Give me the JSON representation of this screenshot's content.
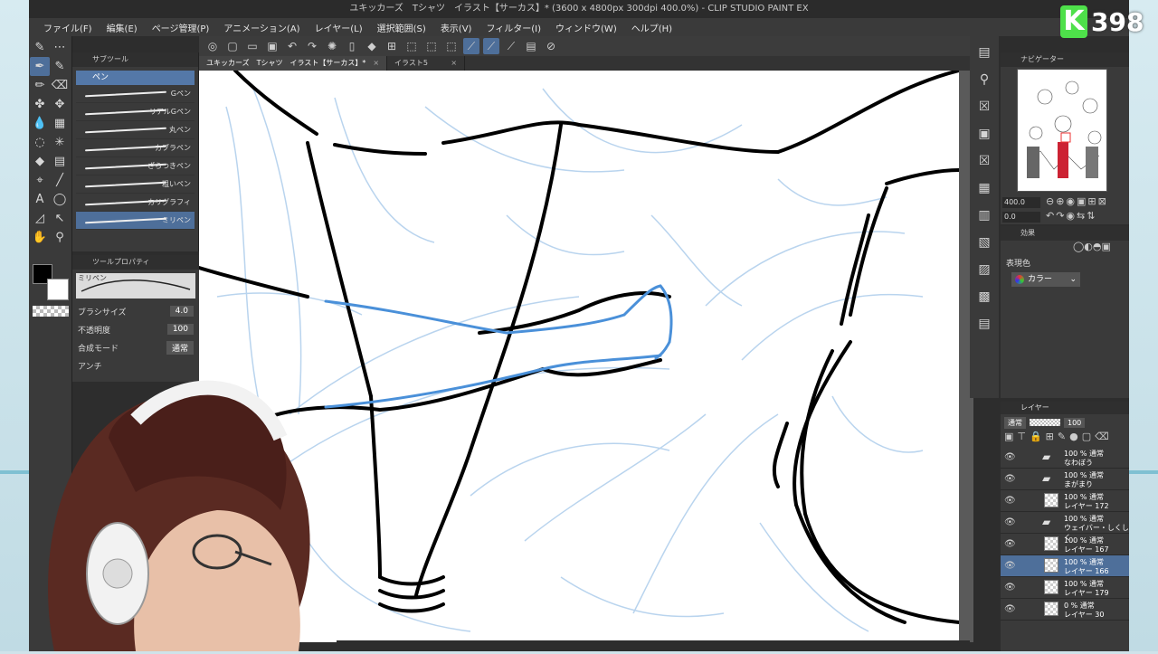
{
  "window": {
    "title": "ユキッカーズ　Tシャツ　イラスト【サーカス】* (3600 x 4800px 300dpi 400.0%) - CLIP STUDIO PAINT EX"
  },
  "menu": [
    "ファイル(F)",
    "編集(E)",
    "ページ管理(P)",
    "アニメーション(A)",
    "レイヤー(L)",
    "選択範囲(S)",
    "表示(V)",
    "フィルター(I)",
    "ウィンドウ(W)",
    "ヘルプ(H)"
  ],
  "document_tabs": [
    {
      "label": "ユキッカーズ　Tシャツ　イラスト【サーカス】*",
      "active": true
    },
    {
      "label": "イラスト5",
      "active": false
    }
  ],
  "subtool": {
    "tab_label": "サブツール",
    "group_label": "ペン",
    "brushes": [
      "Gペン",
      "リアルGペン",
      "丸ペン",
      "カブラペン",
      "ざらつきペン",
      "粗いペン",
      "カリグラフィ",
      "ミリペン"
    ],
    "selected_index": 7
  },
  "tool_property": {
    "tab_label": "ツールプロパティ",
    "preview_label": "ミリペン",
    "brush_size_label": "ブラシサイズ",
    "brush_size_value": "4.0",
    "opacity_label": "不透明度",
    "opacity_value": "100",
    "blend_label": "合成モード",
    "blend_value": "通常",
    "antialias_label": "アンチ"
  },
  "navigator": {
    "tab_label": "ナビゲーター",
    "zoom_value": "400.0",
    "rotate_value": "0.0"
  },
  "effect": {
    "tab_label": "効果",
    "expression_color_label": "表現色",
    "expression_color_value": "カラー"
  },
  "layers": {
    "tab_label": "レイヤー",
    "blend_value": "通常",
    "opacity_value": "100",
    "rows": [
      {
        "percent": "100 % 通常",
        "name": "なわぼう",
        "type": "folder",
        "selected": false
      },
      {
        "percent": "100 % 通常",
        "name": "まがまり",
        "type": "folder",
        "selected": false
      },
      {
        "percent": "100 % 通常",
        "name": "レイヤー 172",
        "type": "layer",
        "selected": false
      },
      {
        "percent": "100 % 通常",
        "name": "ウェイバー・しくしく",
        "type": "folder",
        "selected": false
      },
      {
        "percent": "100 % 通常",
        "name": "レイヤー 167",
        "type": "layer",
        "selected": false
      },
      {
        "percent": "100 % 通常",
        "name": "レイヤー 166",
        "type": "layer",
        "selected": true
      },
      {
        "percent": "100 % 通常",
        "name": "レイヤー 179",
        "type": "layer",
        "selected": false
      },
      {
        "percent": "0 % 通常",
        "name": "レイヤー 30",
        "type": "layer",
        "selected": false
      }
    ]
  },
  "badge": {
    "letter": "K",
    "number": "398"
  },
  "colors": {
    "accent": "#4e6f9a",
    "sketch_blue": "#4a90d9",
    "light_sketch": "#b9d4ee"
  }
}
